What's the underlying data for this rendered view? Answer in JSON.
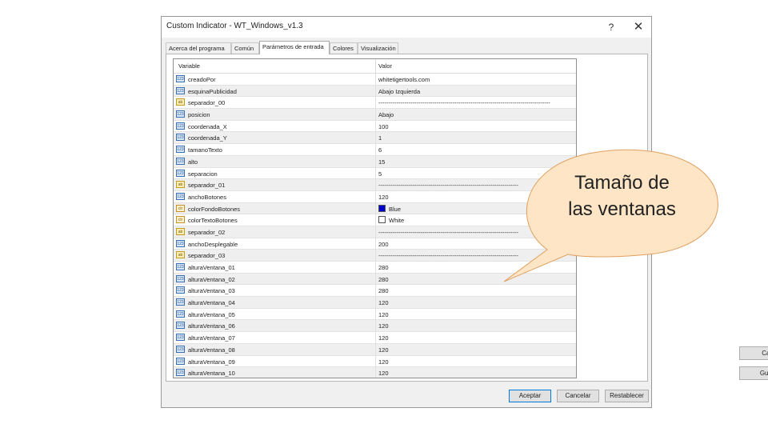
{
  "window": {
    "title": "Custom Indicator - WT_Windows_v1.3",
    "help_label": "?",
    "close_label": "✕"
  },
  "tabs": [
    {
      "label": "Acerca del programa"
    },
    {
      "label": "Común"
    },
    {
      "label": "Parámetros de entrada"
    },
    {
      "label": "Colores"
    },
    {
      "label": "Visualización"
    }
  ],
  "grid": {
    "col_variable": "Variable",
    "col_value": "Valor",
    "rows": [
      {
        "type": "int",
        "icon": "int-type-icon",
        "name": "creadoPor",
        "value": "whitetigertools.com"
      },
      {
        "type": "int",
        "icon": "int-type-icon",
        "name": "esquinaPublicidad",
        "value": "Abajo Izquierda"
      },
      {
        "type": "str",
        "icon": "string-type-icon",
        "name": "separador_00",
        "value": "--------------------------------------------------------------------------------------"
      },
      {
        "type": "int",
        "icon": "int-type-icon",
        "name": "posicion",
        "value": "Abajo"
      },
      {
        "type": "int",
        "icon": "int-type-icon",
        "name": "coordenada_X",
        "value": "100"
      },
      {
        "type": "int",
        "icon": "int-type-icon",
        "name": "coordenada_Y",
        "value": "1"
      },
      {
        "type": "int",
        "icon": "int-type-icon",
        "name": "tamanoTexto",
        "value": "6"
      },
      {
        "type": "int",
        "icon": "int-type-icon",
        "name": "alto",
        "value": "15"
      },
      {
        "type": "int",
        "icon": "int-type-icon",
        "name": "separacion",
        "value": "5"
      },
      {
        "type": "str",
        "icon": "string-type-icon",
        "name": "separador_01",
        "value": "----------------------------------------------------------------------"
      },
      {
        "type": "int",
        "icon": "int-type-icon",
        "name": "anchoBotones",
        "value": "120"
      },
      {
        "type": "clr",
        "icon": "color-type-icon",
        "name": "colorFondoBotones",
        "value": "Blue",
        "swatch": "#0000cc"
      },
      {
        "type": "clr",
        "icon": "color-type-icon",
        "name": "colorTextoBotones",
        "value": "White",
        "swatch": "#ffffff"
      },
      {
        "type": "str",
        "icon": "string-type-icon",
        "name": "separador_02",
        "value": "----------------------------------------------------------------------"
      },
      {
        "type": "int",
        "icon": "int-type-icon",
        "name": "anchoDesplegable",
        "value": "200"
      },
      {
        "type": "str",
        "icon": "string-type-icon",
        "name": "separador_03",
        "value": "----------------------------------------------------------------------"
      },
      {
        "type": "int",
        "icon": "int-type-icon",
        "name": "alturaVentana_01",
        "value": "280"
      },
      {
        "type": "int",
        "icon": "int-type-icon",
        "name": "alturaVentana_02",
        "value": "280"
      },
      {
        "type": "int",
        "icon": "int-type-icon",
        "name": "alturaVentana_03",
        "value": "280"
      },
      {
        "type": "int",
        "icon": "int-type-icon",
        "name": "alturaVentana_04",
        "value": "120"
      },
      {
        "type": "int",
        "icon": "int-type-icon",
        "name": "alturaVentana_05",
        "value": "120"
      },
      {
        "type": "int",
        "icon": "int-type-icon",
        "name": "alturaVentana_06",
        "value": "120"
      },
      {
        "type": "int",
        "icon": "int-type-icon",
        "name": "alturaVentana_07",
        "value": "120"
      },
      {
        "type": "int",
        "icon": "int-type-icon",
        "name": "alturaVentana_08",
        "value": "120"
      },
      {
        "type": "int",
        "icon": "int-type-icon",
        "name": "alturaVentana_09",
        "value": "120"
      },
      {
        "type": "int",
        "icon": "int-type-icon",
        "name": "alturaVentana_10",
        "value": "120"
      }
    ]
  },
  "side_buttons": {
    "load": "Cargar",
    "save": "Guardar"
  },
  "bottom_buttons": {
    "accept": "Aceptar",
    "cancel": "Cancelar",
    "reset": "Restablecer"
  },
  "callout": {
    "line1": "Tamaño de",
    "line2": "las ventanas",
    "fill": "#fde5c6",
    "stroke": "#e0a060"
  },
  "type_badges": {
    "int": "123",
    "str": "ab",
    "clr": "clr"
  }
}
